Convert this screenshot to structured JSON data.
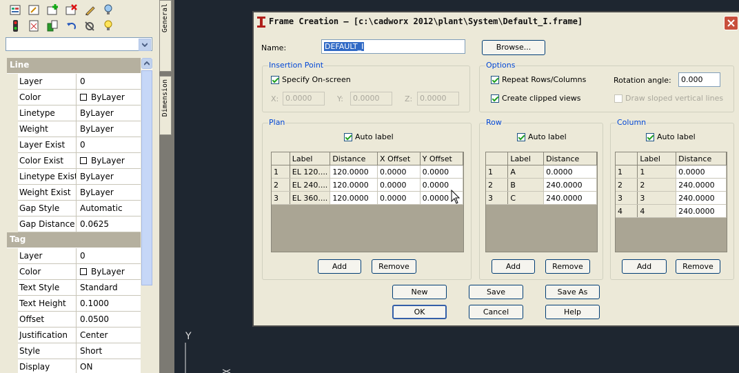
{
  "palette": {
    "toolbar_icons": [
      "properties-icon",
      "edit-icon",
      "add-icon",
      "delete-icon",
      "pencil-icon",
      "bulb-blue-icon",
      "traffic-light-icon",
      "sheet-icon",
      "stack-icon",
      "undo-icon",
      "tools-icon",
      "bulb-yellow-icon"
    ],
    "selector_value": "",
    "categories": [
      {
        "name": "Line",
        "props": [
          {
            "name": "Layer",
            "value": "0",
            "swatch": false
          },
          {
            "name": "Color",
            "value": "ByLayer",
            "swatch": true
          },
          {
            "name": "Linetype",
            "value": "ByLayer",
            "swatch": false
          },
          {
            "name": "Weight",
            "value": "ByLayer",
            "swatch": false
          },
          {
            "name": "Layer Exist",
            "value": "0",
            "swatch": false
          },
          {
            "name": "Color Exist",
            "value": "ByLayer",
            "swatch": true
          },
          {
            "name": "Linetype Exist",
            "value": "ByLayer",
            "swatch": false
          },
          {
            "name": "Weight Exist",
            "value": "ByLayer",
            "swatch": false
          },
          {
            "name": "Gap Style",
            "value": "Automatic",
            "swatch": false
          },
          {
            "name": "Gap Distance",
            "value": "0.0625",
            "swatch": false
          }
        ]
      },
      {
        "name": "Tag",
        "props": [
          {
            "name": "Layer",
            "value": "0",
            "swatch": false
          },
          {
            "name": "Color",
            "value": "ByLayer",
            "swatch": true
          },
          {
            "name": "Text Style",
            "value": "Standard",
            "swatch": false
          },
          {
            "name": "Text Height",
            "value": "0.1000",
            "swatch": false
          },
          {
            "name": "Offset",
            "value": "0.0500",
            "swatch": false
          },
          {
            "name": "Justification",
            "value": "Center",
            "swatch": false
          },
          {
            "name": "Style",
            "value": "Short",
            "swatch": false
          },
          {
            "name": "Display",
            "value": "ON",
            "swatch": false
          }
        ]
      }
    ],
    "tabs": [
      "General",
      "Dimension"
    ]
  },
  "canvas": {
    "axis_label": "Y"
  },
  "dialog": {
    "title": "Frame Creation – [c:\\cadworx 2012\\plant\\System\\Default_I.frame]",
    "name_label": "Name:",
    "name_value": "DEFAULT_I",
    "browse": "Browse...",
    "insertion": {
      "label": "Insertion Point",
      "specify": "Specify On-screen",
      "x_label": "X:",
      "x_value": "0.0000",
      "y_label": "Y:",
      "y_value": "0.0000",
      "z_label": "Z:",
      "z_value": "0.0000"
    },
    "options": {
      "label": "Options",
      "repeat": "Repeat Rows/Columns",
      "clipped": "Create clipped views",
      "rotation_label": "Rotation angle:",
      "rotation_value": "0.000",
      "sloped": "Draw sloped vertical lines"
    },
    "plan": {
      "label": "Plan",
      "auto_label": "Auto label",
      "headers": [
        "Label",
        "Distance",
        "X Offset",
        "Y Offset"
      ],
      "rows": [
        [
          "1",
          "EL 120....",
          "120.0000",
          "0.0000",
          "0.0000"
        ],
        [
          "2",
          "EL 240....",
          "120.0000",
          "0.0000",
          "0.0000"
        ],
        [
          "3",
          "EL 360....",
          "120.0000",
          "0.0000",
          "0.0000"
        ]
      ],
      "add": "Add",
      "remove": "Remove"
    },
    "row": {
      "label": "Row",
      "auto_label": "Auto label",
      "headers": [
        "Label",
        "Distance"
      ],
      "rows": [
        [
          "1",
          "A",
          "0.0000"
        ],
        [
          "2",
          "B",
          "240.0000"
        ],
        [
          "3",
          "C",
          "240.0000"
        ]
      ],
      "add": "Add",
      "remove": "Remove"
    },
    "column": {
      "label": "Column",
      "auto_label": "Auto label",
      "headers": [
        "Label",
        "Distance"
      ],
      "rows": [
        [
          "1",
          "1",
          "0.0000"
        ],
        [
          "2",
          "2",
          "240.0000"
        ],
        [
          "3",
          "3",
          "240.0000"
        ],
        [
          "4",
          "4",
          "240.0000"
        ]
      ],
      "add": "Add",
      "remove": "Remove"
    },
    "buttons": {
      "new": "New",
      "save": "Save",
      "save_as": "Save As",
      "ok": "OK",
      "cancel": "Cancel",
      "help": "Help"
    }
  }
}
